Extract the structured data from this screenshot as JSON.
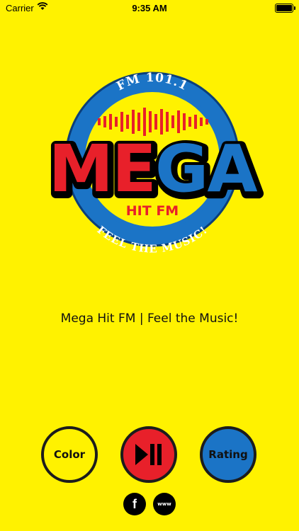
{
  "status_bar": {
    "carrier": "Carrier",
    "time": "9:35 AM",
    "wifi_icon": "wifi-icon",
    "battery_icon": "battery-icon"
  },
  "logo": {
    "frequency": "FM 101.1",
    "brand": "MEGA",
    "subbrand": "HIT FM",
    "slogan": "FEEL THE MUSIC!"
  },
  "tagline": "Mega Hit FM | Feel the Music!",
  "controls": {
    "color_label": "Color",
    "play_icon": "play-pause-icon",
    "rating_label": "Rating"
  },
  "social": {
    "facebook_glyph": "f",
    "web_glyph": "www"
  },
  "colors": {
    "background": "#FFF200",
    "red": "#E8202A",
    "blue": "#1B74C6"
  }
}
